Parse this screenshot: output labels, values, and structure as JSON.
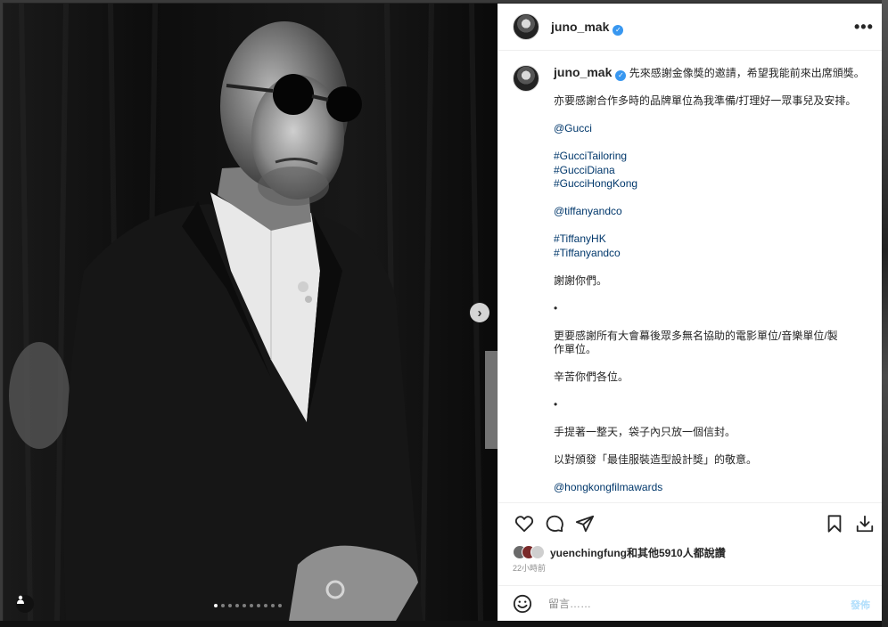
{
  "post": {
    "username": "juno_mak",
    "more_label": "•••",
    "verified_mark": "✓"
  },
  "photo": {
    "next_arrow": "›",
    "carousel_count": 10,
    "carousel_active": 1
  },
  "caption": {
    "first_line": "先來感謝金像獎的邀請，希望我能前來出席頒獎。",
    "line2": "亦要感謝合作多時的品牌單位為我準備/打理好一眾事兒及安排。",
    "mention_gucci": "@Gucci",
    "tag1": "#GucciTailoring",
    "tag2": "#GucciDiana",
    "tag3": "#GucciHongKong",
    "mention_tiffany": "@tiffanyandco",
    "tag4": "#TiffanyHK",
    "tag5": "#Tiffanyandco",
    "thanks": "謝謝你們。",
    "dot1": "•",
    "line_more_thanks": "更要感謝所有大會幕後眾多無名協助的電影單位/音樂單位/製作單位。",
    "hard_work": "辛苦你們各位。",
    "dot2": "•",
    "envelope": "手提著一整天，袋子內只放一個信封。",
    "tribute": "以對頒發「最佳服裝造型設計獎」的敬意。",
    "mention_hkfa": "@hongkongfilmawards"
  },
  "likes": {
    "text": "yuenchingfung和其他5910人都說讚"
  },
  "time_ago": "22小時前",
  "comment": {
    "placeholder": "留言……",
    "post_label": "發佈"
  },
  "colors": {
    "link": "#00376b",
    "verified": "#3897f0",
    "text": "#262626"
  }
}
